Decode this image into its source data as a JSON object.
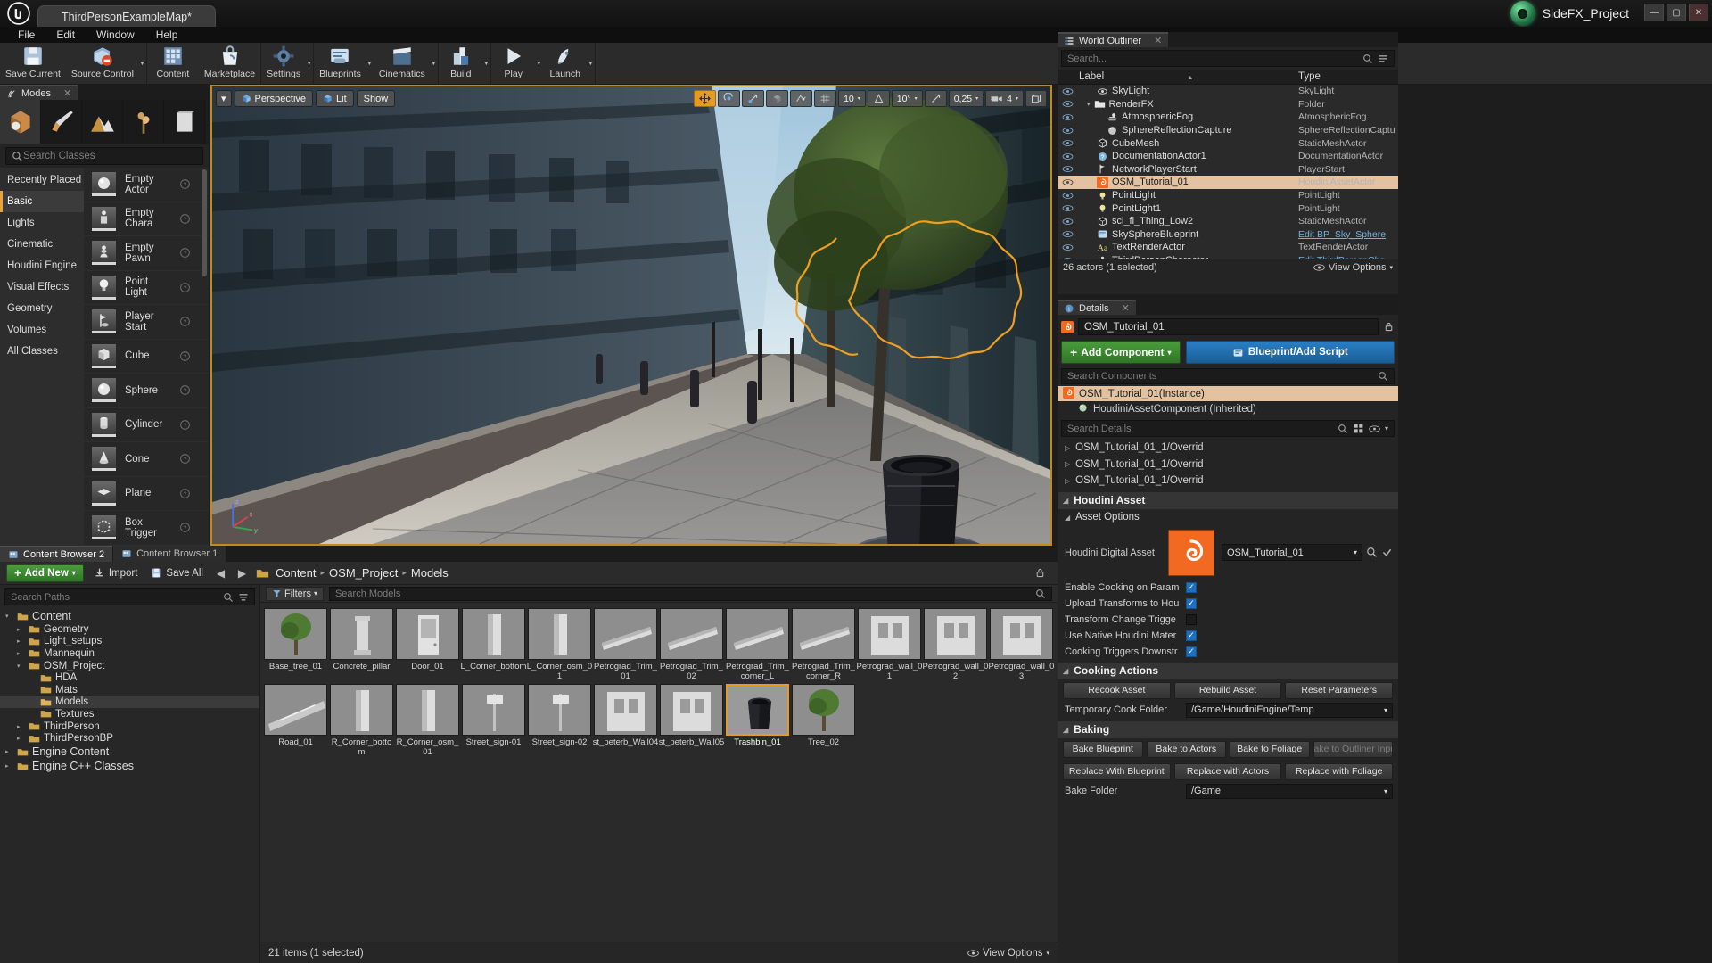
{
  "window": {
    "map_tab": "ThirdPersonExampleMap*",
    "plugin_name": "SideFX_Project",
    "minimize": "—",
    "maximize": "▢",
    "close": "✕"
  },
  "menu": {
    "items": [
      "File",
      "Edit",
      "Window",
      "Help"
    ]
  },
  "toolbar": {
    "groups": [
      {
        "buttons": [
          {
            "label": "Save Current",
            "icon": "floppy-disk-icon",
            "caret": false
          },
          {
            "label": "Source Control",
            "icon": "source-control-icon",
            "caret": true
          }
        ]
      },
      {
        "buttons": [
          {
            "label": "Content",
            "icon": "content-grid-icon",
            "caret": false
          },
          {
            "label": "Marketplace",
            "icon": "marketplace-bag-icon",
            "caret": false
          }
        ]
      },
      {
        "buttons": [
          {
            "label": "Settings",
            "icon": "gear-icon",
            "caret": true
          }
        ]
      },
      {
        "buttons": [
          {
            "label": "Blueprints",
            "icon": "blueprint-icon",
            "caret": true
          },
          {
            "label": "Cinematics",
            "icon": "clapperboard-icon",
            "caret": true
          }
        ]
      },
      {
        "buttons": [
          {
            "label": "Build",
            "icon": "build-icon",
            "caret": true
          }
        ]
      },
      {
        "buttons": [
          {
            "label": "Play",
            "icon": "play-icon",
            "caret": true
          },
          {
            "label": "Launch",
            "icon": "launch-icon",
            "caret": true
          }
        ]
      }
    ]
  },
  "modes": {
    "tab_label": "Modes",
    "tab_icon": "modes-icon",
    "close_icon": "close-icon",
    "mode_icons": [
      {
        "name": "place-mode-icon",
        "active": true
      },
      {
        "name": "paint-mode-icon",
        "active": false
      },
      {
        "name": "landscape-mode-icon",
        "active": false
      },
      {
        "name": "foliage-mode-icon",
        "active": false
      },
      {
        "name": "geometry-edit-mode-icon",
        "active": false
      }
    ],
    "search_placeholder": "Search Classes",
    "search_value": "",
    "categories": [
      {
        "label": "Recently Placed",
        "active": false
      },
      {
        "label": "Basic",
        "active": true
      },
      {
        "label": "Lights",
        "active": false
      },
      {
        "label": "Cinematic",
        "active": false
      },
      {
        "label": "Houdini Engine",
        "active": false
      },
      {
        "label": "Visual Effects",
        "active": false
      },
      {
        "label": "Geometry",
        "active": false
      },
      {
        "label": "Volumes",
        "active": false
      },
      {
        "label": "All Classes",
        "active": false
      }
    ],
    "placeables": [
      {
        "label": "Empty Actor",
        "icon": "sphere-thumb-icon"
      },
      {
        "label": "Empty Chara",
        "icon": "character-thumb-icon"
      },
      {
        "label": "Empty Pawn",
        "icon": "pawn-thumb-icon"
      },
      {
        "label": "Point Light",
        "icon": "bulb-thumb-icon"
      },
      {
        "label": "Player Start",
        "icon": "playerstart-thumb-icon"
      },
      {
        "label": "Cube",
        "icon": "cube-thumb-icon"
      },
      {
        "label": "Sphere",
        "icon": "sphere-thumb-icon"
      },
      {
        "label": "Cylinder",
        "icon": "cylinder-thumb-icon"
      },
      {
        "label": "Cone",
        "icon": "cone-thumb-icon"
      },
      {
        "label": "Plane",
        "icon": "plane-thumb-icon"
      },
      {
        "label": "Box Trigger",
        "icon": "boxtrigger-thumb-icon"
      }
    ]
  },
  "viewport": {
    "menu_caret": "▾",
    "camera_mode": "Perspective",
    "view_mode": "Lit",
    "show_menu": "Show",
    "grid_snap_value": "10",
    "rotation_snap_value": "10°",
    "scale_snap_value": "0,25",
    "camera_speed_value": "4",
    "transform_icons": [
      "move-gizmo-icon",
      "rotate-gizmo-icon",
      "scale-gizmo-icon"
    ],
    "right_icons": [
      "world-space-icon",
      "surface-snap-icon",
      "grid-snap-icon",
      "angle-snap-icon",
      "scale-snap-icon",
      "camera-speed-icon",
      "maximize-viewport-icon"
    ],
    "gizmo_axes": [
      "z",
      "y",
      "x"
    ]
  },
  "outliner": {
    "title": "World Outliner",
    "title_icon": "outliner-icon",
    "close_icon": "close-icon",
    "search_placeholder": "Search...",
    "search_value": "",
    "settings_icon": "outliner-settings-icon",
    "columns": {
      "label": "Label",
      "type": "Type"
    },
    "sort_caret": "▲",
    "rows": [
      {
        "label": "SkyLight",
        "type": "SkyLight",
        "icon": "skylight-icon",
        "indent": 2,
        "selected": false,
        "link": false
      },
      {
        "label": "RenderFX",
        "type": "Folder",
        "icon": "folder-icon",
        "indent": 1,
        "selected": false,
        "link": false,
        "expander": "▾"
      },
      {
        "label": "AtmosphericFog",
        "type": "AtmosphericFog",
        "icon": "fog-icon",
        "indent": 3,
        "selected": false,
        "link": false
      },
      {
        "label": "SphereReflectionCapture",
        "type": "SphereReflectionCaptu",
        "icon": "reflection-icon",
        "indent": 3,
        "selected": false,
        "link": false
      },
      {
        "label": "CubeMesh",
        "type": "StaticMeshActor",
        "icon": "mesh-icon",
        "indent": 2,
        "selected": false,
        "link": false
      },
      {
        "label": "DocumentationActor1",
        "type": "DocumentationActor",
        "icon": "doc-icon",
        "indent": 2,
        "selected": false,
        "link": false
      },
      {
        "label": "NetworkPlayerStart",
        "type": "PlayerStart",
        "icon": "playerstart-icon",
        "indent": 2,
        "selected": false,
        "link": false
      },
      {
        "label": "OSM_Tutorial_01",
        "type": "HoudiniAssetActor",
        "icon": "houdini-icon",
        "indent": 2,
        "selected": true,
        "link": false
      },
      {
        "label": "PointLight",
        "type": "PointLight",
        "icon": "pointlight-icon",
        "indent": 2,
        "selected": false,
        "link": false
      },
      {
        "label": "PointLight1",
        "type": "PointLight",
        "icon": "pointlight-icon",
        "indent": 2,
        "selected": false,
        "link": false
      },
      {
        "label": "sci_fi_Thing_Low2",
        "type": "StaticMeshActor",
        "icon": "mesh-icon",
        "indent": 2,
        "selected": false,
        "link": false
      },
      {
        "label": "SkySphereBlueprint",
        "type": "Edit BP_Sky_Sphere",
        "icon": "blueprint-small-icon",
        "indent": 2,
        "selected": false,
        "link": true
      },
      {
        "label": "TextRenderActor",
        "type": "TextRenderActor",
        "icon": "text-icon",
        "indent": 2,
        "selected": false,
        "link": false
      },
      {
        "label": "ThirdPersonCharacter",
        "type": "Edit ThirdPersonCha",
        "icon": "character-icon",
        "indent": 2,
        "selected": false,
        "link": true
      }
    ],
    "status": "26 actors (1 selected)",
    "view_options": "View Options",
    "view_options_icon": "eye-icon",
    "view_options_caret": "▾"
  },
  "details": {
    "title": "Details",
    "title_icon": "details-icon",
    "close_icon": "close-icon",
    "actor_name": "OSM_Tutorial_01",
    "actor_icon": "houdini-icon",
    "lock_icon": "lock-icon",
    "add_component_label": "Add Component",
    "add_component_caret": "▾",
    "blueprint_label": "Blueprint/Add Script",
    "blueprint_icon": "blueprint-small-icon",
    "search_components_placeholder": "Search Components",
    "search_components_value": "",
    "components": [
      {
        "label": "OSM_Tutorial_01(Instance)",
        "icon": "houdini-icon",
        "selected": true,
        "child": false
      },
      {
        "label": "HoudiniAssetComponent (Inherited)",
        "icon": "houdini-component-icon",
        "selected": false,
        "child": true
      }
    ],
    "search_details_placeholder": "Search Details",
    "search_details_value": "",
    "search_details_icon": "search-icon",
    "layout_icons": [
      "grid-view-icon",
      "eye-icon",
      "chevron-down-icon"
    ],
    "override_rows": [
      "OSM_Tutorial_01_1/Overrid",
      "OSM_Tutorial_01_1/Overrid",
      "OSM_Tutorial_01_1/Overrid"
    ],
    "houdini_asset_header": "Houdini Asset",
    "asset_options_header": "Asset Options",
    "hda_label": "Houdini Digital Asset",
    "hda_value": "OSM_Tutorial_01",
    "hda_caret": "▾",
    "hda_browse_icon": "browse-icon",
    "hda_use_icon": "use-selected-icon",
    "checkboxes": [
      {
        "label": "Enable Cooking on Param",
        "checked": true
      },
      {
        "label": "Upload Transforms to Hou",
        "checked": true
      },
      {
        "label": "Transform Change Trigge",
        "checked": false
      },
      {
        "label": "Use Native Houdini Mater",
        "checked": true
      },
      {
        "label": "Cooking Triggers Downstr",
        "checked": true
      }
    ],
    "cooking_actions_header": "Cooking Actions",
    "cooking_buttons": [
      "Recook Asset",
      "Rebuild Asset",
      "Reset Parameters"
    ],
    "temp_cook_folder_label": "Temporary Cook Folder",
    "temp_cook_folder_value": "/Game/HoudiniEngine/Temp",
    "temp_cook_caret": "▾",
    "baking_header": "Baking",
    "bake_row1": [
      "Bake Blueprint",
      "Bake to Actors",
      "Bake to Foliage",
      "Bake to Outliner Input"
    ],
    "bake_row1_disabled": [
      false,
      false,
      false,
      true
    ],
    "bake_row2": [
      "Replace With Blueprint",
      "Replace with Actors",
      "Replace with Foliage"
    ],
    "bake_folder_label": "Bake Folder",
    "bake_folder_value": "/Game",
    "bake_folder_caret": "▾"
  },
  "content_browser": {
    "tabs": [
      {
        "label": "Content Browser 2",
        "icon": "content-browser-icon",
        "active": true
      },
      {
        "label": "Content Browser 1",
        "icon": "content-browser-icon",
        "active": false
      }
    ],
    "add_new_label": "Add New",
    "add_new_caret": "▾",
    "import_label": "Import",
    "import_icon": "import-icon",
    "save_all_label": "Save All",
    "save_all_icon": "save-all-icon",
    "back_icon": "arrow-left-icon",
    "forward_icon": "arrow-right-icon",
    "folder_icon": "folder-icon",
    "breadcrumb": [
      "Content",
      "OSM_Project",
      "Models"
    ],
    "breadcrumb_sep": "▸",
    "lock_icon": "lock-icon",
    "paths_search_placeholder": "Search Paths",
    "paths_search_value": "",
    "tree": [
      {
        "label": "Content",
        "depth": 0,
        "tri": "▾",
        "big": true,
        "sel": false
      },
      {
        "label": "Geometry",
        "depth": 1,
        "tri": "▸",
        "big": false,
        "sel": false
      },
      {
        "label": "Light_setups",
        "depth": 1,
        "tri": "▸",
        "big": false,
        "sel": false
      },
      {
        "label": "Mannequin",
        "depth": 1,
        "tri": "▸",
        "big": false,
        "sel": false
      },
      {
        "label": "OSM_Project",
        "depth": 1,
        "tri": "▾",
        "big": false,
        "sel": false
      },
      {
        "label": "HDA",
        "depth": 2,
        "tri": "",
        "big": false,
        "sel": false
      },
      {
        "label": "Mats",
        "depth": 2,
        "tri": "",
        "big": false,
        "sel": false
      },
      {
        "label": "Models",
        "depth": 2,
        "tri": "",
        "big": false,
        "sel": true
      },
      {
        "label": "Textures",
        "depth": 2,
        "tri": "",
        "big": false,
        "sel": false
      },
      {
        "label": "ThirdPerson",
        "depth": 1,
        "tri": "▸",
        "big": false,
        "sel": false
      },
      {
        "label": "ThirdPersonBP",
        "depth": 1,
        "tri": "▸",
        "big": false,
        "sel": false
      },
      {
        "label": "Engine Content",
        "depth": 0,
        "tri": "▸",
        "big": true,
        "sel": false
      },
      {
        "label": "Engine C++ Classes",
        "depth": 0,
        "tri": "▸",
        "big": true,
        "sel": false
      }
    ],
    "filters_label": "Filters",
    "filters_caret": "▾",
    "assets_search_placeholder": "Search Models",
    "assets_search_value": "",
    "assets_search_icon": "search-icon",
    "assets": [
      {
        "name": "Base_tree_01",
        "kind": "tree",
        "selected": false
      },
      {
        "name": "Concrete_pillar",
        "kind": "pillar",
        "selected": false
      },
      {
        "name": "Door_01",
        "kind": "door",
        "selected": false
      },
      {
        "name": "L_Corner_bottom",
        "kind": "corner",
        "selected": false
      },
      {
        "name": "L_Corner_osm_01",
        "kind": "corner",
        "selected": false
      },
      {
        "name": "Petrograd_Trim_01",
        "kind": "trim",
        "selected": false
      },
      {
        "name": "Petrograd_Trim_02",
        "kind": "trim",
        "selected": false
      },
      {
        "name": "Petrograd_Trim_corner_L",
        "kind": "trim",
        "selected": false
      },
      {
        "name": "Petrograd_Trim_corner_R",
        "kind": "trim",
        "selected": false
      },
      {
        "name": "Petrograd_wall_01",
        "kind": "wall",
        "selected": false
      },
      {
        "name": "Petrograd_wall_02",
        "kind": "wall",
        "selected": false
      },
      {
        "name": "Petrograd_wall_03",
        "kind": "wall",
        "selected": false
      },
      {
        "name": "Road_01",
        "kind": "road",
        "selected": false
      },
      {
        "name": "R_Corner_bottom",
        "kind": "corner",
        "selected": false
      },
      {
        "name": "R_Corner_osm_01",
        "kind": "corner",
        "selected": false
      },
      {
        "name": "Street_sign-01",
        "kind": "sign",
        "selected": false
      },
      {
        "name": "Street_sign-02",
        "kind": "sign",
        "selected": false
      },
      {
        "name": "st_peterb_Wall04",
        "kind": "wall",
        "selected": false
      },
      {
        "name": "st_peterb_Wall05",
        "kind": "wall",
        "selected": false
      },
      {
        "name": "Trashbin_01",
        "kind": "trash",
        "selected": true
      },
      {
        "name": "Tree_02",
        "kind": "tree",
        "selected": false
      }
    ],
    "status": "21 items (1 selected)",
    "view_options": "View Options",
    "view_options_icon": "eye-icon",
    "view_options_caret": "▾"
  },
  "colors": {
    "accent_orange": "#e79a21",
    "selection_tan": "#e2c2a0",
    "green_button": "#3f8a33",
    "blue_button": "#226fad",
    "houdini_orange": "#f26a21",
    "link_blue": "#6fb3e0"
  }
}
